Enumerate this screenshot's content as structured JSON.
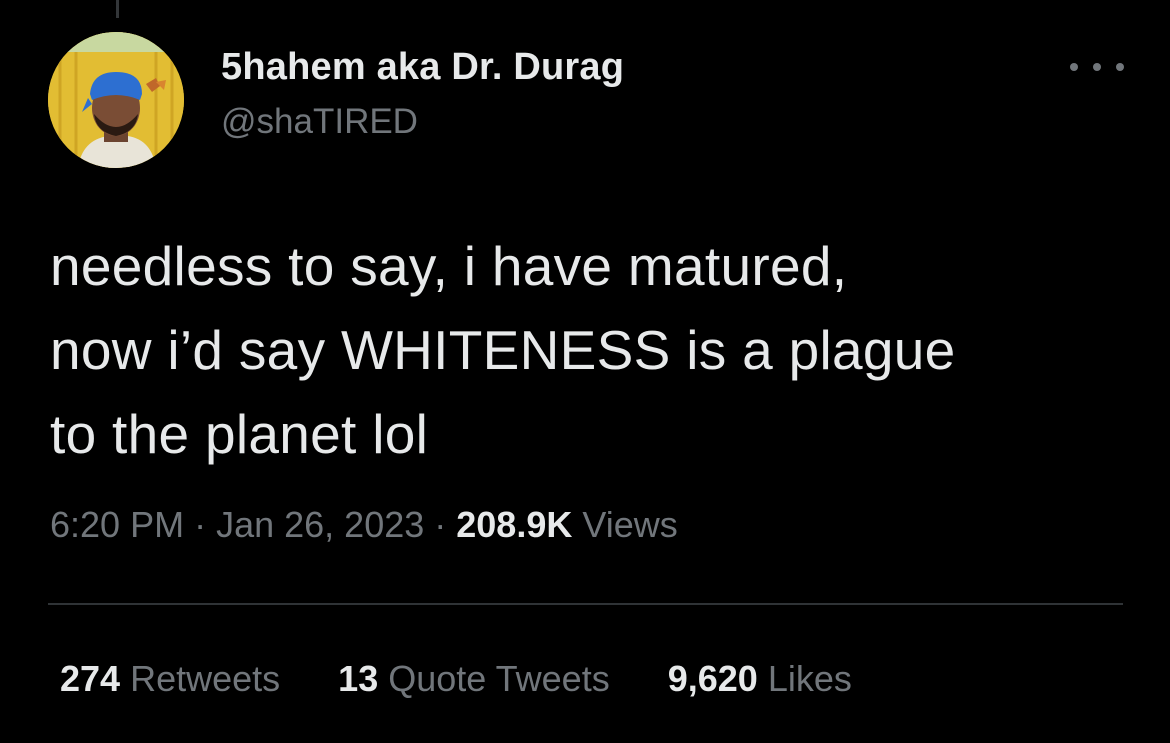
{
  "tweet": {
    "author_name": "5hahem aka Dr. Durag",
    "author_handle": "@shaTIRED",
    "text_lines": [
      "needless to say, i have matured,",
      "now i’d say WHITENESS is a plague",
      "to the planet lol"
    ],
    "time": "6:20 PM",
    "separator": "·",
    "date": "Jan 26, 2023",
    "views_count": "208.9K",
    "views_label": "Views",
    "more_icon": "more-horizontal-icon"
  },
  "stats": {
    "retweets_count": "274",
    "retweets_label": "Retweets",
    "quotes_count": "13",
    "quotes_label": "Quote Tweets",
    "likes_count": "9,620",
    "likes_label": "Likes"
  },
  "colors": {
    "background": "#000000",
    "primary_text": "#e7e9ea",
    "secondary_text": "#71767b",
    "divider": "#2f3336"
  }
}
